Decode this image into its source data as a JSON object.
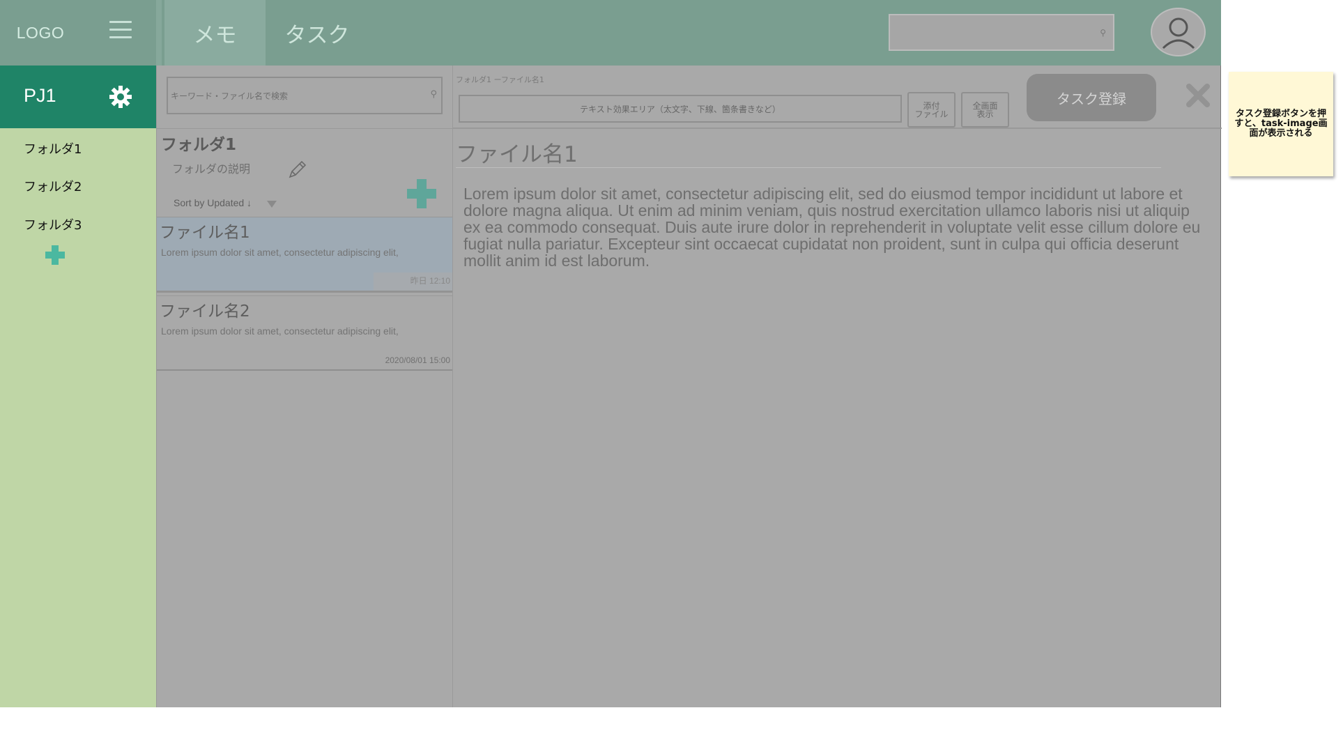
{
  "header": {
    "logo": "LOGO",
    "tabs": [
      {
        "label": "メモ",
        "active": true
      },
      {
        "label": "タスク",
        "active": false
      }
    ],
    "search_placeholder": ""
  },
  "sidebar": {
    "project_name": "PJ1",
    "folders": [
      {
        "label": "フォルダ1"
      },
      {
        "label": "フォルダ2"
      },
      {
        "label": "フォルダ3"
      }
    ]
  },
  "file_list": {
    "search_placeholder": "キーワード・ファイル名で検索",
    "folder_title": "フォルダ1",
    "folder_description": "フォルダの説明",
    "sort_label": "Sort by Updated ↓",
    "files": [
      {
        "name": "ファイル名1",
        "snippet": "Lorem ipsum dolor sit amet, consectetur adipiscing elit,",
        "date": "昨日 12:10",
        "selected": true
      },
      {
        "name": "ファイル名2",
        "snippet": "Lorem ipsum dolor sit amet, consectetur adipiscing elit,",
        "date": "2020/08/01 15:00",
        "selected": false
      }
    ]
  },
  "editor": {
    "breadcrumb": "フォルダ1 ーファイル名1",
    "format_area": "テキスト効果エリア（太文字、下線、箇条書きなど）",
    "attach_button": "添付\nファイル",
    "fullscreen_button": "全画面\n表示",
    "task_register_button": "タスク登録",
    "title": "ファイル名1",
    "body": "Lorem ipsum dolor sit amet, consectetur adipiscing elit, sed do eiusmod tempor incididunt ut labore et dolore magna aliqua. Ut enim ad minim veniam, quis nostrud exercitation ullamco laboris nisi ut aliquip ex ea commodo consequat. Duis aute irure dolor in reprehenderit in voluptate velit esse cillum dolore eu fugiat nulla pariatur. Excepteur sint occaecat cupidatat non proident, sunt in culpa qui officia deserunt mollit anim id est laborum."
  },
  "sticky_note": {
    "text": "タスク登録ボタンを押すと、task-image画面が表示される"
  },
  "colors": {
    "header": "#7a9e90",
    "project_bar": "#1f8467",
    "sidebar": "#bfd6a6",
    "accent_plus": "#4bb8a0",
    "overlay_gray": "#a9a9a9",
    "sticky": "#fff8d6"
  },
  "icons": [
    "menu-icon",
    "search-icon",
    "user-icon",
    "gear-icon",
    "plus-icon",
    "pencil-icon",
    "sort-down-icon",
    "close-icon"
  ]
}
